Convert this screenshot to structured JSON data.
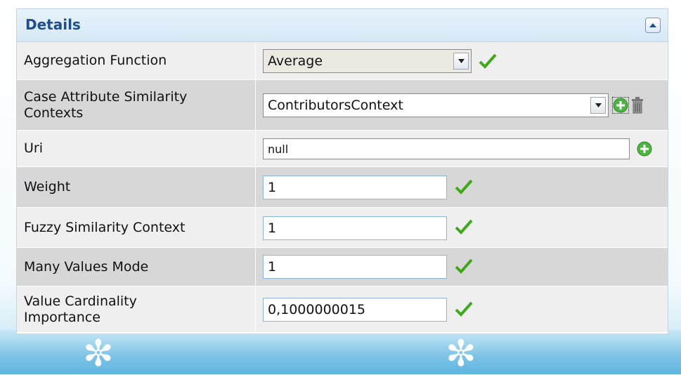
{
  "panel": {
    "title": "Details"
  },
  "rows": {
    "aggregation": {
      "label": "Aggregation Function",
      "value": "Average"
    },
    "case_attr": {
      "label": "Case Attribute Similarity Contexts",
      "value": "ContributorsContext"
    },
    "uri": {
      "label": "Uri",
      "value": "null"
    },
    "weight": {
      "label": "Weight",
      "value": "1"
    },
    "fuzzy": {
      "label": "Fuzzy Similarity Context",
      "value": "1"
    },
    "many_values": {
      "label": "Many Values Mode",
      "value": "1"
    },
    "cardinality": {
      "label": "Value Cardinality Importance",
      "value": "0,1000000015"
    }
  },
  "icons": {
    "collapse": "chevron-up-icon",
    "dropdown": "chevron-down-icon",
    "check": "checkmark-icon",
    "add": "plus-circle-icon",
    "delete": "trash-icon"
  },
  "colors": {
    "header_title": "#1f4f8b",
    "check": "#3fa81d",
    "add_icon": "#4bb540",
    "row_light": "#efefef",
    "row_dark": "#d7d7d7"
  }
}
